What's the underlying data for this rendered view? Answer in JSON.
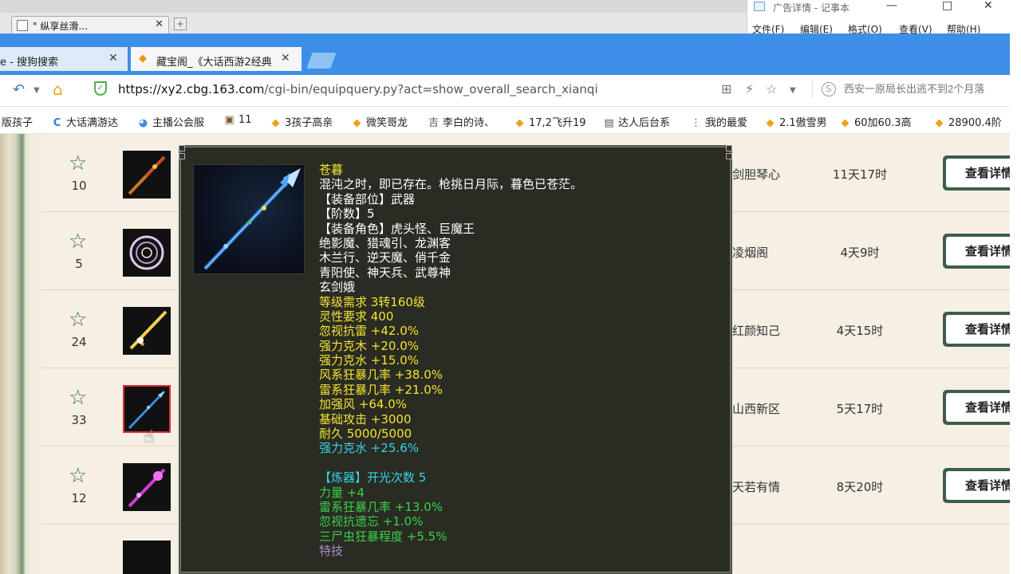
{
  "window": {
    "blink_tab_title": "\" 纵享丝滑...",
    "new_tab_symbol": "+"
  },
  "notepad": {
    "title": "广告详情 - 记事本",
    "menu": [
      "文件(F)",
      "编辑(E)",
      "格式(O)",
      "查看(V)",
      "帮助(H)"
    ],
    "minimize": "—",
    "maximize": "□",
    "close": "✕"
  },
  "browser": {
    "tabs": [
      {
        "label": "e - 搜狗搜索",
        "close": "✕"
      },
      {
        "label": "藏宝阁_《大话西游2经典",
        "close": "✕"
      }
    ],
    "url_host": "https://xy2.cbg.163.com",
    "url_path": "/cgi-bin/equipquery.py?act=show_overall_search_xianqi",
    "search_placeholder": "西安一原局长出逃不到2个月落",
    "bookmarks": [
      {
        "label": "版孩子",
        "icon": ""
      },
      {
        "label": "大话满游达",
        "icon": "C"
      },
      {
        "label": "主播公会服",
        "icon": "◕"
      },
      {
        "label": "11",
        "icon": "▣"
      },
      {
        "label": "3孩子高亲",
        "icon": "◆"
      },
      {
        "label": "微笑哥龙",
        "icon": "◆"
      },
      {
        "label": "李白的诗、",
        "icon": "吉"
      },
      {
        "label": "17,2飞升19",
        "icon": "◆"
      },
      {
        "label": "达人后台系",
        "icon": "▤"
      },
      {
        "label": "我的最爱",
        "icon": "⋮⋮"
      },
      {
        "label": "2.1傲雪男",
        "icon": "◆"
      },
      {
        "label": "60加60.3高",
        "icon": "◆"
      },
      {
        "label": "28900.4阶",
        "icon": "◆"
      }
    ]
  },
  "listing": {
    "view_label": "查看详情",
    "rows": [
      {
        "num": "10",
        "seller": "剑胆琴心",
        "time": "11天17时"
      },
      {
        "num": "5",
        "seller": "凌烟阁",
        "time": "4天9时"
      },
      {
        "num": "24",
        "seller": "红颜知己",
        "time": "4天15时"
      },
      {
        "num": "33",
        "seller": "山西新区",
        "time": "5天17时"
      },
      {
        "num": "12",
        "seller": "天若有情",
        "time": "8天20时"
      }
    ]
  },
  "tooltip": {
    "lines": [
      {
        "text": "苍暮",
        "color": "yellow"
      },
      {
        "text": "混沌之时，即已存在。枪挑日月际，暮色已苍茫。",
        "color": "white"
      },
      {
        "text": "【装备部位】武器",
        "color": "white"
      },
      {
        "text": "【阶数】5",
        "color": "white"
      },
      {
        "text": "【装备角色】虎头怪、巨魔王",
        "color": "white"
      },
      {
        "text": "绝影魔、猎魂引、龙渊客",
        "color": "white"
      },
      {
        "text": "木兰行、逆天魔、俏千金",
        "color": "white"
      },
      {
        "text": "青阳使、神天兵、武尊神",
        "color": "white"
      },
      {
        "text": "玄剑娥",
        "color": "white"
      },
      {
        "text": "等级需求 3转160级",
        "color": "yellow"
      },
      {
        "text": "灵性要求 400",
        "color": "yellow"
      },
      {
        "text": "忽视抗雷 +42.0%",
        "color": "yellow"
      },
      {
        "text": "强力克木 +20.0%",
        "color": "yellow"
      },
      {
        "text": "强力克水 +15.0%",
        "color": "yellow"
      },
      {
        "text": "风系狂暴几率 +38.0%",
        "color": "yellow"
      },
      {
        "text": "雷系狂暴几率 +21.0%",
        "color": "yellow"
      },
      {
        "text": "加强风 +64.0%",
        "color": "yellow"
      },
      {
        "text": "基础攻击 +3000",
        "color": "yellow"
      },
      {
        "text": "耐久 5000/5000",
        "color": "yellow"
      },
      {
        "text": "强力克水 +25.6%",
        "color": "cyan"
      },
      {
        "text": "",
        "color": "white"
      },
      {
        "text": "【炼器】开光次数 5",
        "color": "cyan"
      },
      {
        "text": "力量 +4",
        "color": "green"
      },
      {
        "text": "雷系狂暴几率 +13.0%",
        "color": "green"
      },
      {
        "text": "忽视抗遗忘 +1.0%",
        "color": "green"
      },
      {
        "text": "三尸虫狂暴程度 +5.5%",
        "color": "green"
      },
      {
        "text": "特技",
        "color": "purple"
      }
    ]
  },
  "colors": {
    "tabbar": "#3d8ee8",
    "tooltip_bg": "#2a2b22",
    "button": "#3e5d4c",
    "yellow": "#f2e433",
    "cyan": "#32d4e8",
    "green": "#37d34a",
    "purple": "#a48fd1"
  }
}
